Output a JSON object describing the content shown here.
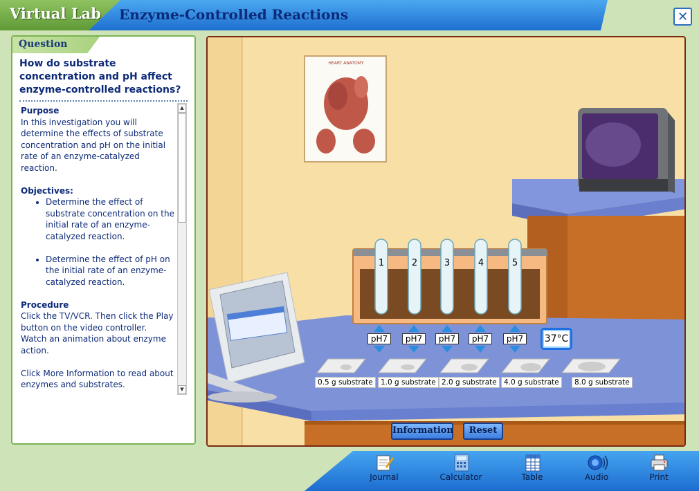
{
  "header": {
    "logo": "Virtual Lab",
    "title": "Enzyme-Controlled Reactions",
    "close_label": "✕"
  },
  "question": {
    "tab_label": "Question",
    "text": "How do substrate concentration and pH affect enzyme-controlled reactions?"
  },
  "content": {
    "purpose_heading": "Purpose",
    "purpose_text": "In this investigation you will determine the effects of substrate concentration and pH on the initial rate of an enzyme-catalyzed reaction.",
    "objectives_heading": "Objectives:",
    "objectives": [
      "Determine the effect of substrate concentration on the initial rate of an enzyme-catalyzed reaction.",
      "Determine the effect of pH on the initial rate of an enzyme-catalyzed reaction."
    ],
    "procedure_heading": "Procedure",
    "procedure_p1": "Click the TV/VCR. Then click the Play button on the video controller. Watch an animation about enzyme action.",
    "procedure_p2": "Click More Information to read about enzymes and substrates."
  },
  "scene": {
    "poster_title": "HEART ANATOMY",
    "tubes": [
      {
        "number": "1",
        "ph": "pH7",
        "substrate": "0.5 g substrate"
      },
      {
        "number": "2",
        "ph": "pH7",
        "substrate": "1.0 g substrate"
      },
      {
        "number": "3",
        "ph": "pH7",
        "substrate": "2.0 g substrate"
      },
      {
        "number": "4",
        "ph": "pH7",
        "substrate": "4.0 g substrate"
      },
      {
        "number": "5",
        "ph": "pH7",
        "substrate": "8.0 g substrate"
      }
    ],
    "temperature": "37°C",
    "information_button": "Information",
    "reset_button": "Reset"
  },
  "toolbar": {
    "journal": "Journal",
    "calculator": "Calculator",
    "table": "Table",
    "audio": "Audio",
    "print": "Print"
  },
  "colors": {
    "header_blue": "#1f6fd0",
    "header_green": "#5f9a37",
    "question_text": "#0d2a78",
    "wall": "#f7dfa6",
    "counter_top": "#7f92d8",
    "cabinet": "#c9712a"
  }
}
